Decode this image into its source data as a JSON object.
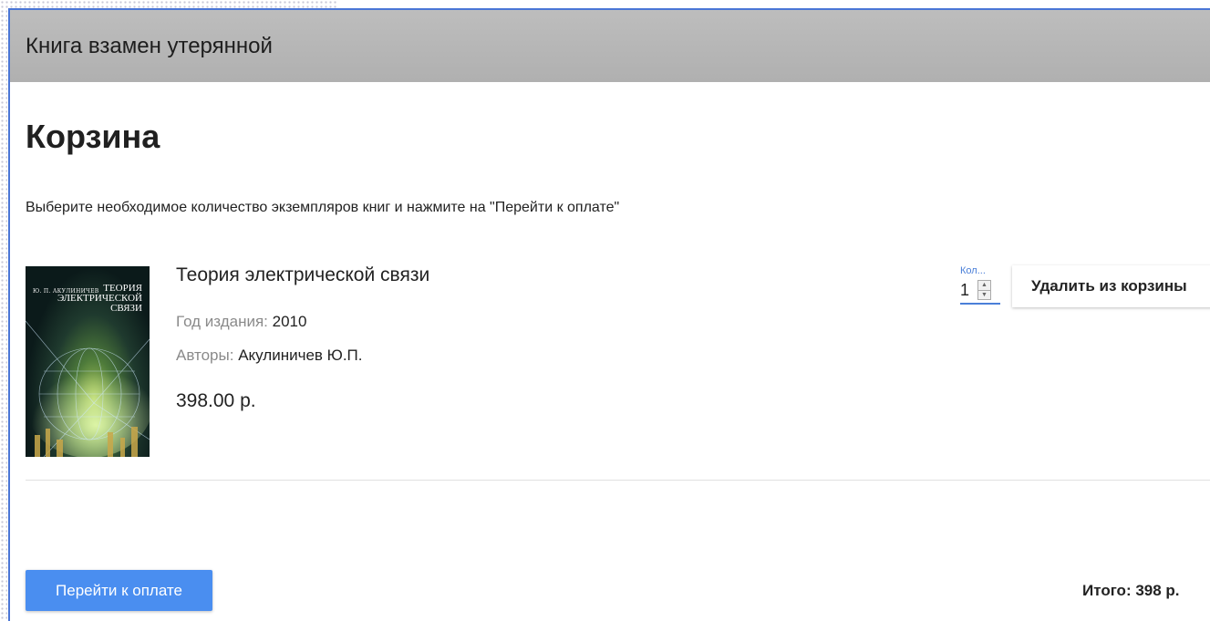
{
  "appbar": {
    "title": "Книга взамен утерянной"
  },
  "page": {
    "title": "Корзина",
    "instruction": "Выберите необходимое количество экземпляров книг и нажмите на \"Перейти к оплате\""
  },
  "cart": {
    "items": [
      {
        "cover": {
          "author": "Ю. П. АКУЛИНИЧЕВ",
          "title_lines": [
            "ТЕОРИЯ",
            "ЭЛЕКТРИЧЕСКОЙ",
            "СВЯЗИ"
          ]
        },
        "title": "Теория электрической связи",
        "year_label": "Год издания:",
        "year": "2010",
        "authors_label": "Авторы:",
        "authors": "Акулиничев Ю.П.",
        "price": "398.00 р.",
        "quantity_label": "Кол...",
        "quantity": "1",
        "remove_label": "Удалить из корзины"
      }
    ]
  },
  "footer": {
    "pay_label": "Перейти к оплате",
    "total": "Итого: 398 р."
  },
  "colors": {
    "accent": "#4a8ef0",
    "appbar": "#b5b5b5",
    "frame": "#4a76d6"
  },
  "icons": [
    "spinner-up-icon",
    "spinner-down-icon"
  ]
}
